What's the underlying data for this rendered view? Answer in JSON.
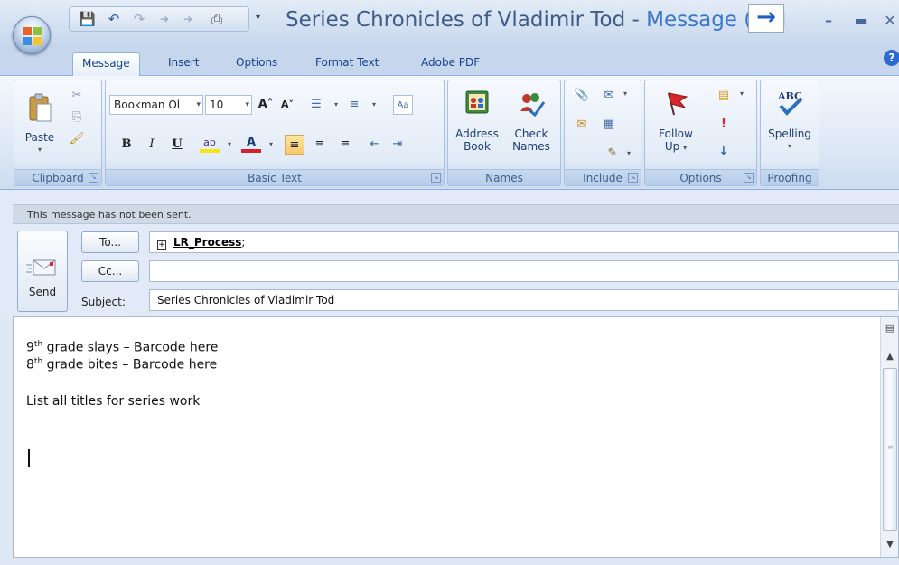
{
  "window": {
    "title_doc": "Series Chronicles of Vladimir Tod",
    "title_sep": " - ",
    "title_app": "Message (HTI"
  },
  "tabs": [
    "Message",
    "Insert",
    "Options",
    "Format Text",
    "Adobe PDF"
  ],
  "ribbon": {
    "clipboard": {
      "label": "Clipboard",
      "paste": "Paste"
    },
    "basic_text": {
      "label": "Basic Text",
      "font": "Bookman Ol",
      "size": "10"
    },
    "names": {
      "label": "Names",
      "address_book_1": "Address",
      "address_book_2": "Book",
      "check_names_1": "Check",
      "check_names_2": "Names"
    },
    "include": {
      "label": "Include"
    },
    "options": {
      "label": "Options",
      "follow_up_1": "Follow",
      "follow_up_2": "Up"
    },
    "proofing": {
      "label": "Proofing",
      "spelling": "Spelling"
    }
  },
  "message": {
    "info": "This message has not been sent.",
    "send": "Send",
    "to_button": "To...",
    "cc_button": "Cc...",
    "subject_label": "Subject:",
    "to_value": "LR_Process",
    "to_suffix": ";",
    "cc_value": "",
    "subject_value": "Series Chronicles of Vladimir Tod"
  },
  "body": {
    "line1_num": "9",
    "line1_sup": "th",
    "line1_rest": " grade slays – Barcode here",
    "line2_num": "8",
    "line2_sup": "th",
    "line2_rest": " grade bites – Barcode here",
    "line3": "List all titles for series work"
  },
  "colors": {
    "accent": "#15428b",
    "ribbon_bg": "#dfe9f6",
    "follow_up_flag": "#d9262c"
  }
}
